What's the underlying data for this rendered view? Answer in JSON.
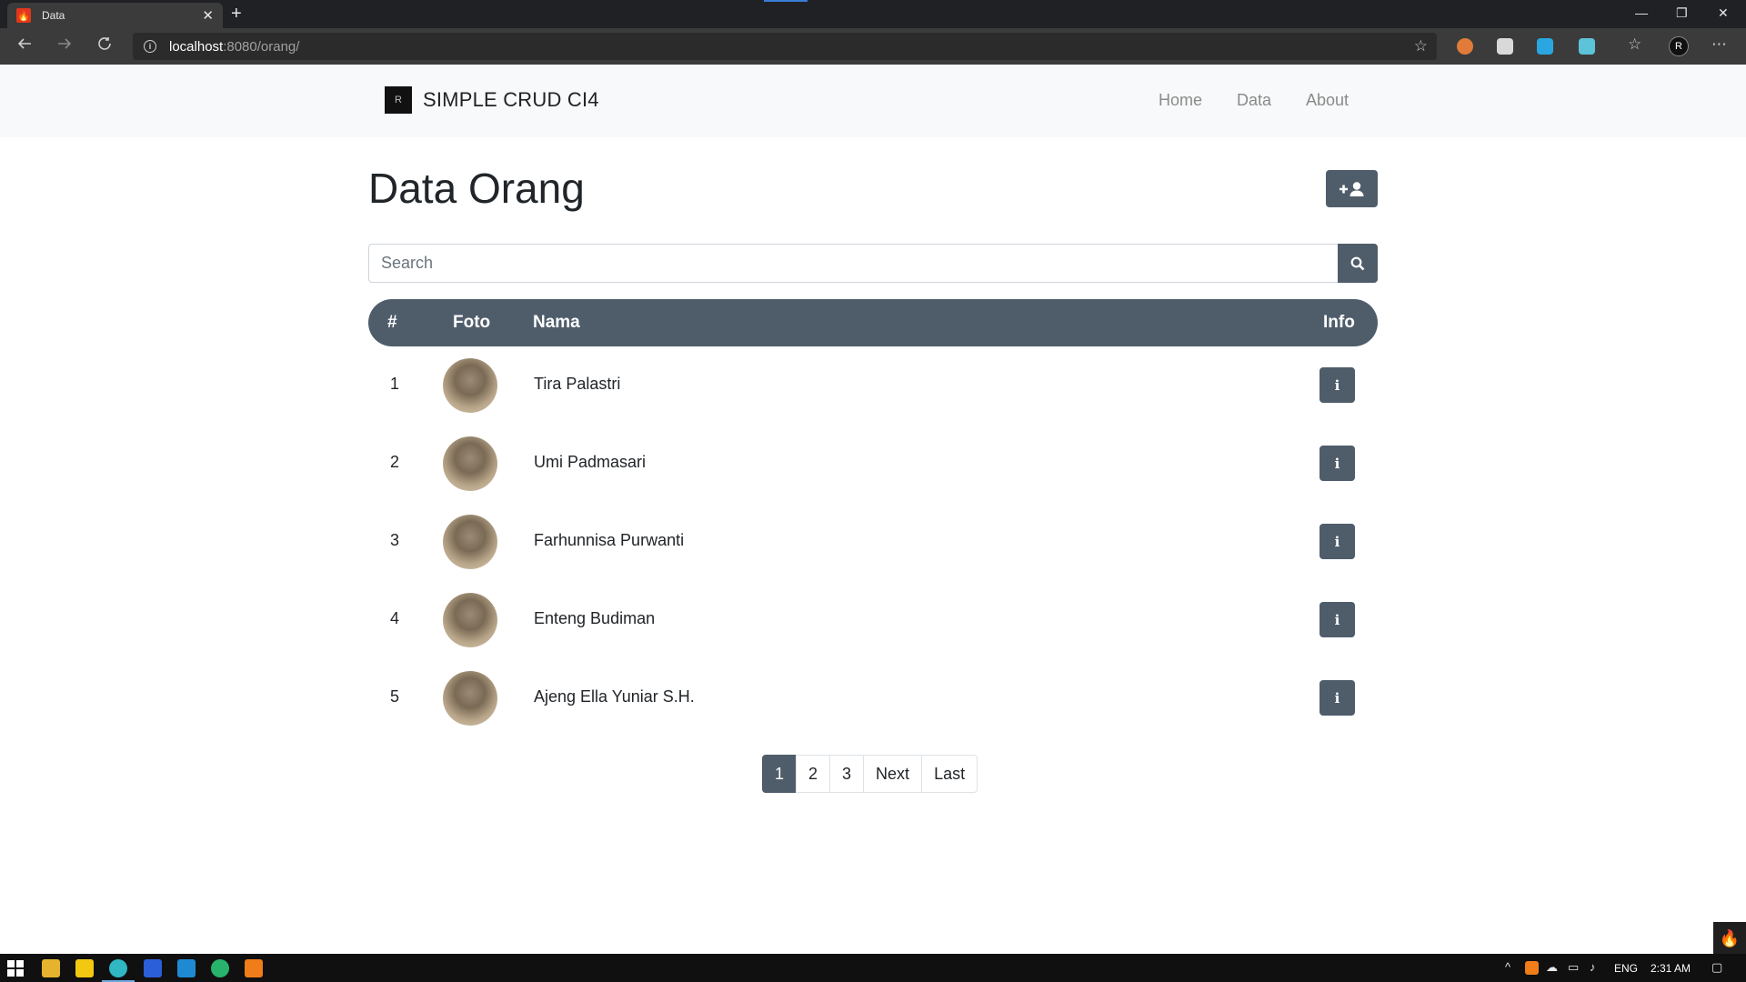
{
  "browser": {
    "tab_title": "Data",
    "tab_close": "✕",
    "new_tab": "+",
    "url_host": "localhost",
    "url_rest": ":8080/orang/",
    "window_controls": [
      "—",
      "❐",
      "✕"
    ],
    "nav_icons": [
      "back-icon",
      "forward-icon",
      "refresh-icon"
    ],
    "extension_icons": [
      "extension-1-icon",
      "extension-2-icon",
      "extension-3-icon",
      "extension-4-icon"
    ],
    "colors": {
      "frame": "#202124",
      "toolbar": "#3b3b3b",
      "omnibox": "#2b2b2b"
    }
  },
  "navbar": {
    "brand": "SIMPLE CRUD CI4",
    "links": [
      "Home",
      "Data",
      "About"
    ]
  },
  "main": {
    "title": "Data Orang",
    "add_button_icon": "user-plus-icon",
    "search": {
      "placeholder": "Search",
      "value": "",
      "button_icon": "search-icon"
    },
    "table": {
      "headers": [
        "#",
        "Foto",
        "Nama",
        "Info"
      ],
      "rows": [
        {
          "no": "1",
          "nama": "Tira Palastri"
        },
        {
          "no": "2",
          "nama": "Umi Padmasari"
        },
        {
          "no": "3",
          "nama": "Farhunnisa Purwanti"
        },
        {
          "no": "4",
          "nama": "Enteng Budiman"
        },
        {
          "no": "5",
          "nama": "Ajeng Ella Yuniar S.H."
        }
      ],
      "info_icon": "info-icon"
    },
    "pagination": [
      "1",
      "2",
      "3",
      "Next",
      "Last"
    ],
    "active_page": "1"
  },
  "taskbar": {
    "language": "ENG",
    "time": "2:31 AM",
    "icons": [
      "start-icon",
      "file-explorer-icon",
      "sticky-notes-icon",
      "edge-icon",
      "powershell-icon",
      "vscode-icon",
      "edge-dev-icon",
      "xampp-icon"
    ]
  },
  "colors": {
    "accent": "#4f5d6b",
    "navbar_bg": "#f8f9fa",
    "text": "#212529"
  }
}
